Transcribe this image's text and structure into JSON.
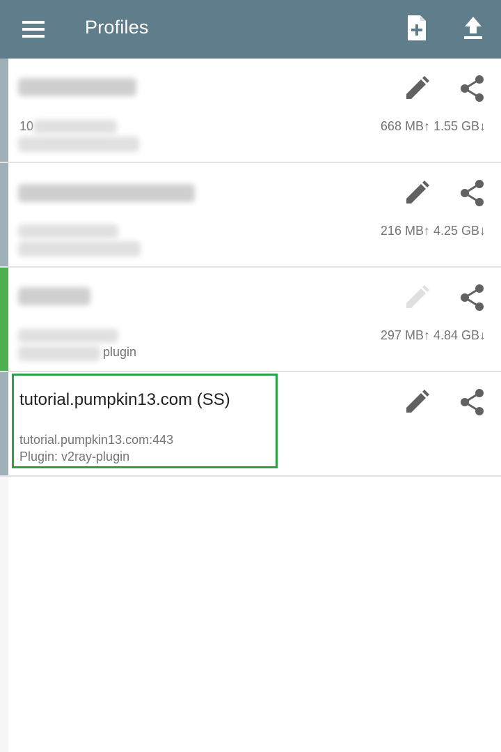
{
  "appbar": {
    "title": "Profiles",
    "icons": {
      "menu": "menu-icon",
      "add": "add-file-icon",
      "upload": "upload-icon"
    },
    "color": "#607d8b"
  },
  "profiles": [
    {
      "name": "",
      "host": "10",
      "plugin": "",
      "traffic": "668 MB↑ 1.55 GB↓",
      "edit_enabled": true,
      "active": false
    },
    {
      "name": "",
      "host": "",
      "plugin": "",
      "traffic": "216 MB↑ 4.25 GB↓",
      "edit_enabled": true,
      "active": false
    },
    {
      "name": "",
      "host": "",
      "plugin": "plugin",
      "traffic": "297 MB↑ 4.84 GB↓",
      "edit_enabled": false,
      "active": true
    },
    {
      "name": "tutorial.pumpkin13.com (SS)",
      "host": "tutorial.pumpkin13.com:443",
      "plugin": "Plugin: v2ray-plugin",
      "traffic": "",
      "edit_enabled": true,
      "active": false
    }
  ],
  "colors": {
    "active_indicator": "#4caf50",
    "highlight": "#2ea043",
    "icon": "#616161"
  }
}
